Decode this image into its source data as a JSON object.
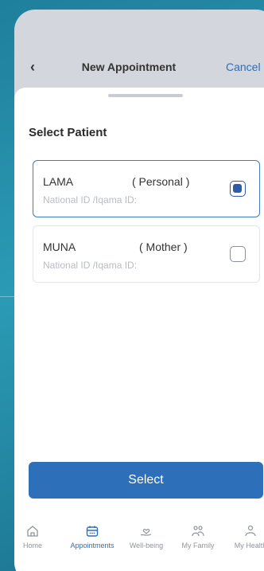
{
  "header": {
    "back_icon": "chevron-left-icon",
    "title": "New Appointment",
    "cancel_label": "Cancel"
  },
  "sheet": {
    "title": "Select Patient",
    "patients": [
      {
        "name": "LAMA",
        "relation": "( Personal )",
        "id_label": "National ID /Iqama ID:",
        "selected": true
      },
      {
        "name": "MUNA",
        "relation": "( Mother )",
        "id_label": "National ID /Iqama ID:",
        "selected": false
      }
    ],
    "select_label": "Select"
  },
  "tabbar": {
    "items": [
      {
        "label": "Home",
        "icon": "home-icon",
        "active": false
      },
      {
        "label": "Appointments",
        "icon": "calendar-icon",
        "active": true
      },
      {
        "label": "Well-being",
        "icon": "wellbeing-icon",
        "active": false
      },
      {
        "label": "My Family",
        "icon": "family-icon",
        "active": false
      },
      {
        "label": "My Health",
        "icon": "person-icon",
        "active": false
      }
    ]
  },
  "colors": {
    "accent": "#2d6fb8",
    "background_teal": "#2b9bb5"
  }
}
